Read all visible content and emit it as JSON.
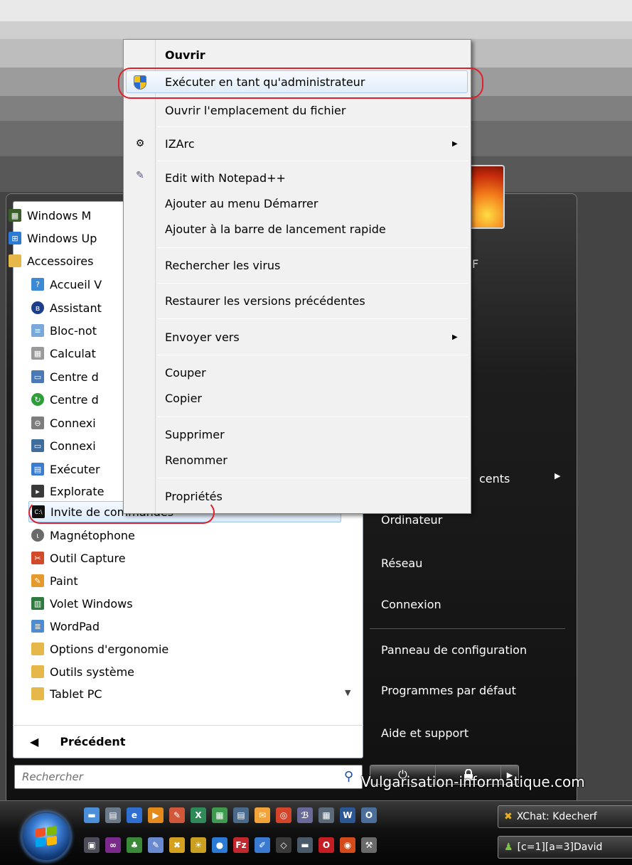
{
  "context_menu": {
    "open_label": "Ouvrir",
    "run_as_admin_label": "Exécuter en tant qu'administrateur",
    "open_location_label": "Ouvrir l'emplacement du fichier",
    "izarc_label": "IZArc",
    "edit_notepad_label": "Edit with Notepad++",
    "add_start_menu_label": "Ajouter au menu Démarrer",
    "add_quick_launch_label": "Ajouter à la barre de lancement rapide",
    "scan_virus_label": "Rechercher les virus",
    "restore_versions_label": "Restaurer les versions précédentes",
    "send_to_label": "Envoyer vers",
    "cut_label": "Couper",
    "copy_label": "Copier",
    "delete_label": "Supprimer",
    "rename_label": "Renommer",
    "properties_label": "Propriétés"
  },
  "programs": {
    "media_center": "Windows M",
    "windows_update": "Windows Up",
    "accessories": "Accessoires",
    "welcome": "Accueil V",
    "assistant": "Assistant",
    "notepad": "Bloc-not",
    "calculator": "Calculat",
    "center1": "Centre d",
    "center2": "Centre d",
    "connection1": "Connexi",
    "connection2": "Connexi",
    "run": "Exécuter",
    "explorer": "Explorate",
    "command_prompt": "Invite de commandes",
    "recorder": "Magnétophone",
    "snipping": "Outil Capture",
    "paint": "Paint",
    "sidebar": "Volet Windows",
    "wordpad": "WordPad",
    "ease_access": "Options d'ergonomie",
    "system_tools": "Outils système",
    "tablet_pc": "Tablet PC"
  },
  "back_label": "Précédent",
  "search_placeholder": "Rechercher",
  "right_panel": {
    "user_partial": "F",
    "recent_partial": "cents",
    "computer": "Ordinateur",
    "network": "Réseau",
    "connect": "Connexion",
    "control_panel": "Panneau de configuration",
    "default_programs": "Programmes par défaut",
    "help": "Aide et support"
  },
  "watermark": "Vulgarisation-informatique.com",
  "taskbar": {
    "task1": "XChat: Kdecherf",
    "task2": "[c=1][a=3]David"
  },
  "colors": {
    "annotation": "#e0202a",
    "highlight_border": "#a9cbed"
  }
}
